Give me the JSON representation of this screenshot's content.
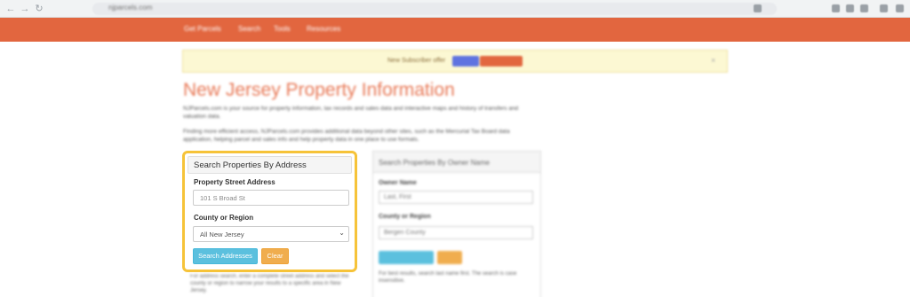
{
  "browser": {
    "url": "njparcels.com"
  },
  "nav": {
    "links": [
      "Get Parcels",
      "Search",
      "Tools",
      "Resources"
    ]
  },
  "alert": {
    "text": "New Subscriber offer",
    "button1": "",
    "button2": ""
  },
  "page": {
    "title": "New Jersey Property Information",
    "intro": [
      "NJParcels.com is your source for property information, tax records and sales data and interactive maps and history of transfers and valuation data.",
      "Finding more efficient access, NJParcels.com provides additional data beyond other sites, such as the Mercurial Tax Board data application, helping parcel and sales info and help property data in one place to use formats."
    ]
  },
  "search_by_address": {
    "heading": "Search Properties By Address",
    "street_label": "Property Street Address",
    "street_value": "101 S Broad St",
    "county_label": "County or Region",
    "county_selected": "All New Jersey",
    "search_button": "Search Addresses",
    "clear_button": "Clear",
    "below_note": "For address search, enter a complete street address and select the county or region to narrow your results to a specific area in New Jersey."
  },
  "search_by_owner": {
    "heading": "Search Properties By Owner Name",
    "owner_label": "Owner Name",
    "owner_value": "Last, First",
    "county_label": "County or Region",
    "county_value": "Bergen County",
    "note": "For best results, search last name first. The search is case insensitive."
  }
}
